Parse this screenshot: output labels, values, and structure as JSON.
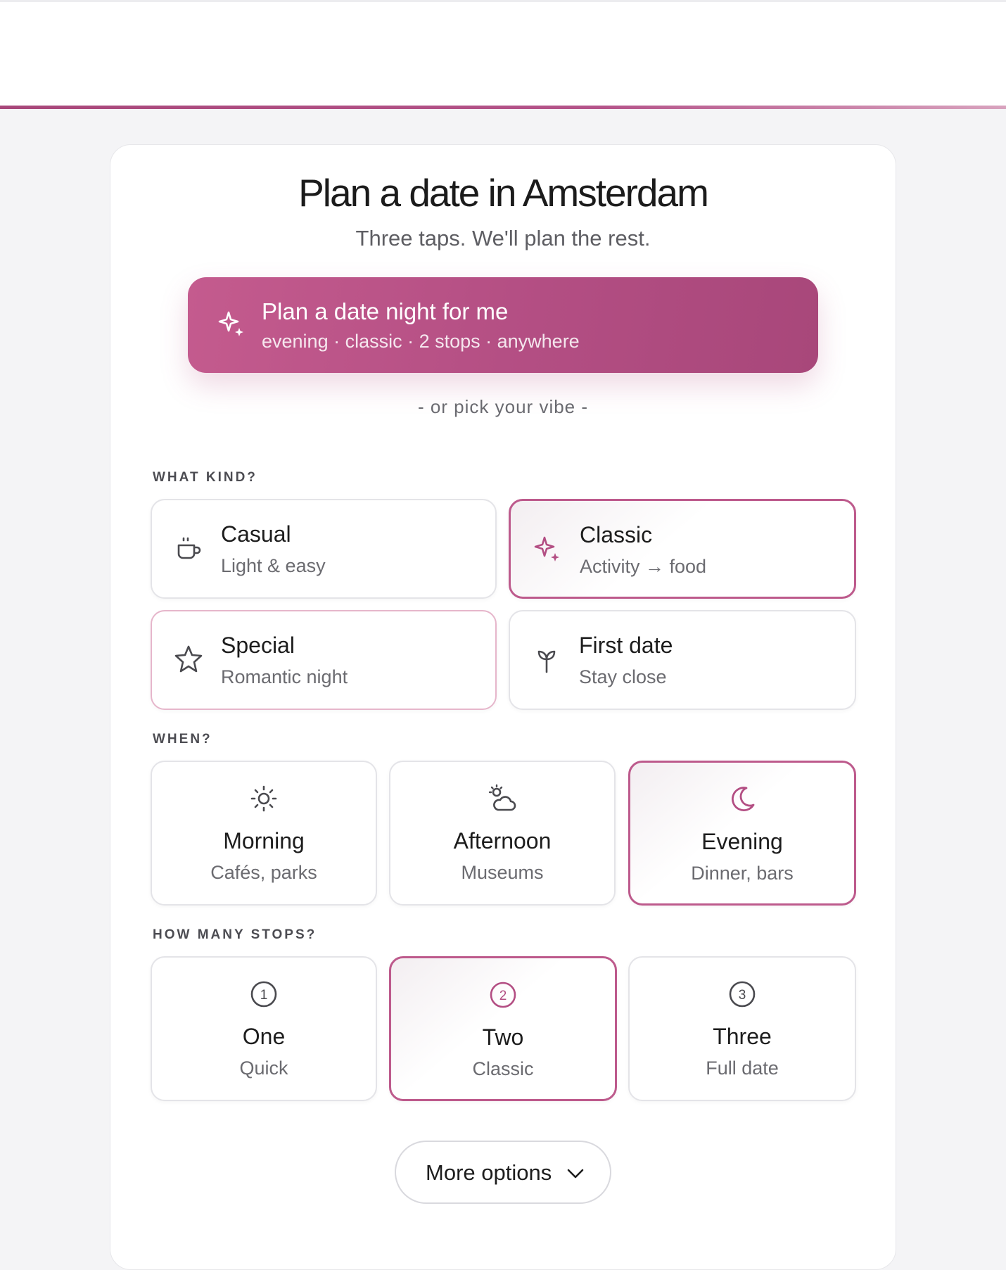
{
  "colors": {
    "accent": "#b34e83",
    "accent_light": "#e6b6cb",
    "text": "#1d1d1d",
    "muted": "#6b6b70"
  },
  "header": {
    "title": "Plan a date in Amsterdam",
    "subtitle": "Three taps. We'll plan the rest."
  },
  "hero": {
    "icon": "sparkle-icon",
    "title": "Plan a date night for me",
    "summary": "evening · classic · 2 stops · anywhere"
  },
  "divider_text": "- or pick your vibe -",
  "kind": {
    "label": "WHAT KIND?",
    "options": [
      {
        "icon": "coffee-cup-icon",
        "label": "Casual",
        "sub": "Light & easy",
        "selected": false
      },
      {
        "icon": "sparkle-icon",
        "label": "Classic",
        "sub": "Activity → food",
        "selected": true
      },
      {
        "icon": "star-icon",
        "label": "Special",
        "sub": "Romantic night",
        "selected": false
      },
      {
        "icon": "sprout-icon",
        "label": "First date",
        "sub": "Stay close",
        "selected": false
      }
    ]
  },
  "when": {
    "label": "WHEN?",
    "options": [
      {
        "icon": "sun-icon",
        "label": "Morning",
        "sub": "Cafés, parks",
        "selected": false
      },
      {
        "icon": "sun-cloud-icon",
        "label": "Afternoon",
        "sub": "Museums",
        "selected": false
      },
      {
        "icon": "moon-icon",
        "label": "Evening",
        "sub": "Dinner, bars",
        "selected": true
      }
    ]
  },
  "stops": {
    "label": "HOW MANY STOPS?",
    "options": [
      {
        "icon": "circle-1-icon",
        "num": "1",
        "label": "One",
        "sub": "Quick",
        "selected": false
      },
      {
        "icon": "circle-2-icon",
        "num": "2",
        "label": "Two",
        "sub": "Classic",
        "selected": true
      },
      {
        "icon": "circle-3-icon",
        "num": "3",
        "label": "Three",
        "sub": "Full date",
        "selected": false
      }
    ]
  },
  "more_options": {
    "label": "More options",
    "icon": "chevron-down-icon"
  }
}
